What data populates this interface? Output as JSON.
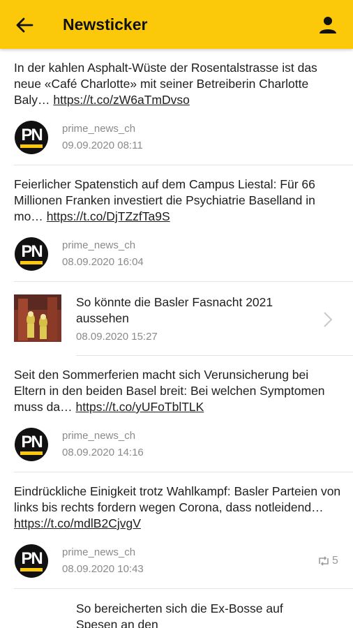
{
  "appbar": {
    "title": "Newsticker",
    "back_icon": "arrow-left-icon",
    "user_icon": "person-icon",
    "background": "#fbc90a"
  },
  "feed": [
    {
      "type": "tweet",
      "text": "In der kahlen Asphalt-Wüste der Rosentalstrasse ist das neue «Café Charlotte» mit seiner Betreiberin Charlotte Baly… ",
      "link": "https://t.co/zW6aTmDvso",
      "user": "prime_news_ch",
      "date": "09.09.2020 08:11"
    },
    {
      "type": "tweet",
      "text": "Feierlicher Spatenstich auf dem Campus Liestal: Für 66 Millionen Franken investiert die Psychiatrie Baselland in mo… ",
      "link": "https://t.co/DjTZzfTa9S",
      "user": "prime_news_ch",
      "date": "08.09.2020 16:04"
    },
    {
      "type": "article",
      "title": "So könnte die Basler Fasnacht 2021 aussehen",
      "date": "08.09.2020 15:27"
    },
    {
      "type": "tweet",
      "text": "Seit den Sommerferien macht sich Verunsicherung bei Eltern in den beiden Basel breit: Bei welchen Symptomen muss da… ",
      "link": "https://t.co/yUFoTblTLK",
      "user": "prime_news_ch",
      "date": "08.09.2020 14:16"
    },
    {
      "type": "tweet",
      "text": "Eindrückliche Einigkeit trotz Wahlkampf: Basler Parteien von links bis rechts fordern wegen Corona, dass notleidend… ",
      "link": "https://t.co/mdlB2CjvgV",
      "user": "prime_news_ch",
      "date": "08.09.2020 10:43",
      "retweets": "5"
    },
    {
      "type": "article",
      "title": "So bereicherten sich die Ex-Bosse auf Spesen an den"
    }
  ],
  "logo_text": "PN"
}
